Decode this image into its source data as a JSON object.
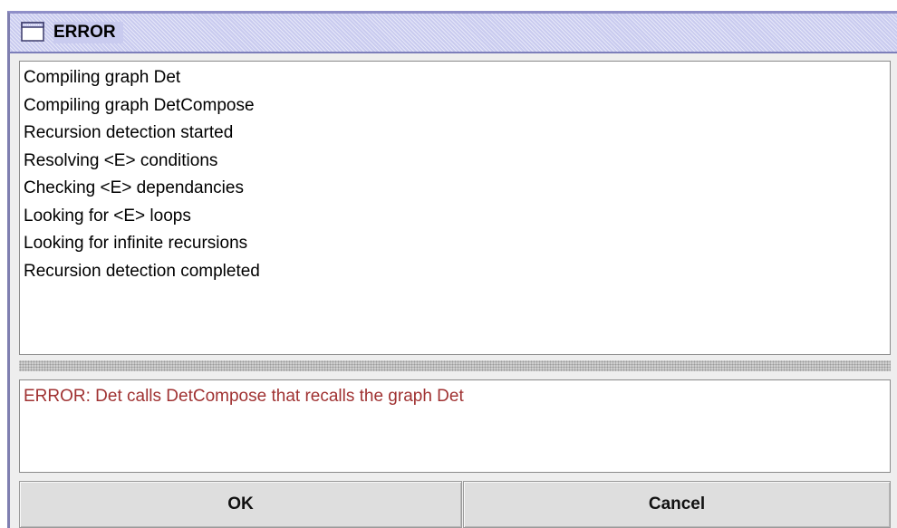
{
  "window": {
    "title": "ERROR",
    "icon": "window-icon"
  },
  "log": {
    "lines": [
      "Compiling graph Det",
      "Compiling graph DetCompose",
      "Recursion detection started",
      "Resolving <E> conditions",
      "Checking <E> dependancies",
      "Looking for <E> loops",
      "Looking for infinite recursions",
      "Recursion detection completed"
    ]
  },
  "error": {
    "message": "ERROR: Det calls DetCompose that recalls the graph Det",
    "color": "#a03232"
  },
  "buttons": {
    "ok_label": "OK",
    "cancel_label": "Cancel"
  },
  "colors": {
    "titlebar": "#c9cbef",
    "window_border": "#7f7fb0"
  }
}
